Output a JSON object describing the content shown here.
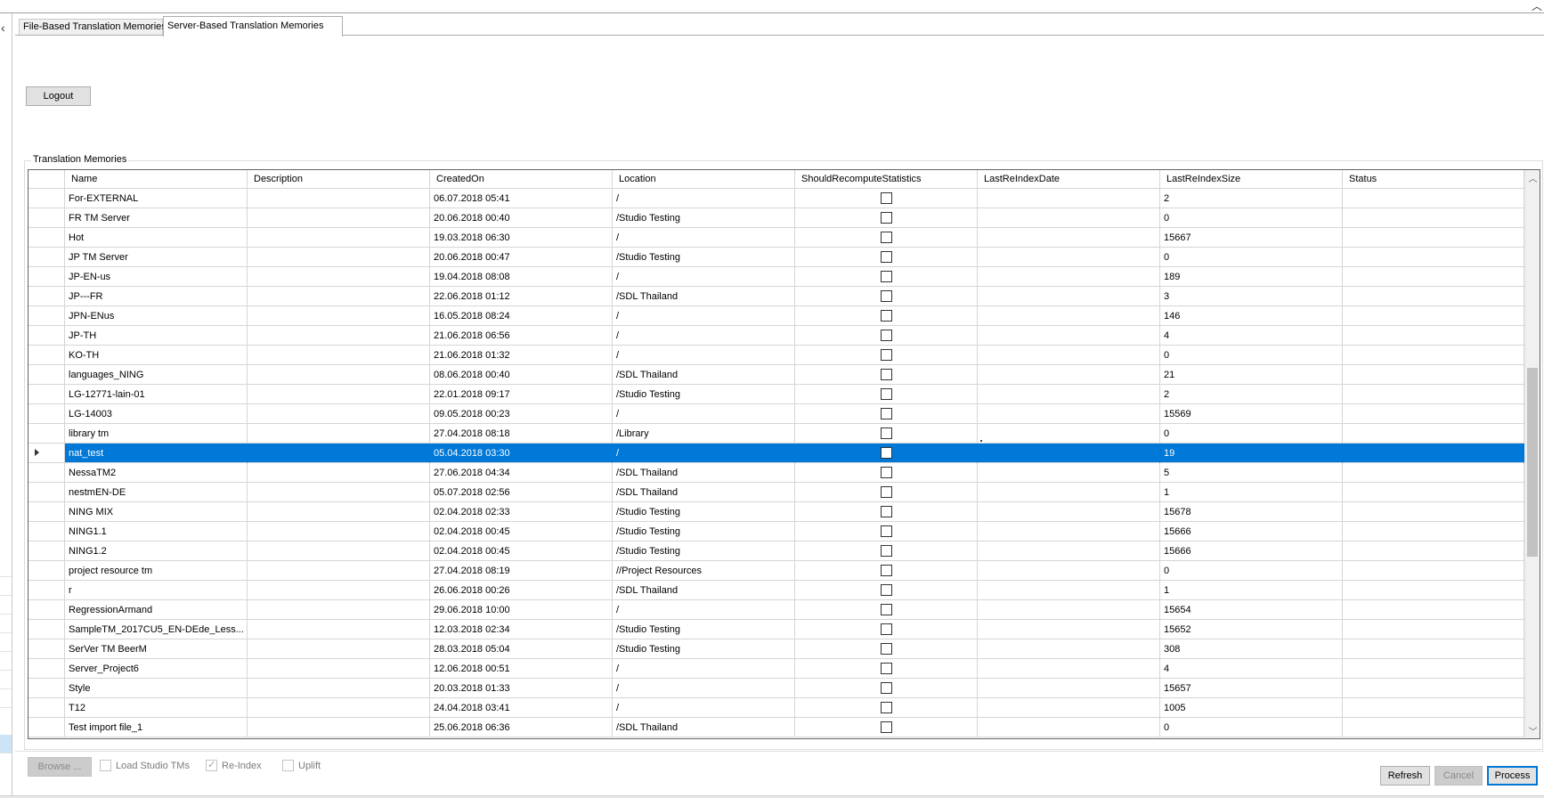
{
  "tabs": [
    {
      "label": "File-Based Translation Memories"
    },
    {
      "label": "Server-Based Translation Memories"
    }
  ],
  "logout_label": "Logout",
  "group_title": "Translation Memories",
  "columns": [
    "Name",
    "Description",
    "CreatedOn",
    "Location",
    "ShouldRecomputeStatistics",
    "LastReIndexDate",
    "LastReIndexSize",
    "Status"
  ],
  "rows": [
    {
      "name": "For-EXTERNAL",
      "description": "",
      "created": "06.07.2018 05:41",
      "location": "/",
      "recompute": false,
      "reindex_date": "",
      "reindex_size": "2",
      "status": ""
    },
    {
      "name": "FR TM Server",
      "description": "",
      "created": "20.06.2018 00:40",
      "location": "/Studio Testing",
      "recompute": false,
      "reindex_date": "",
      "reindex_size": "0",
      "status": ""
    },
    {
      "name": "Hot",
      "description": "",
      "created": "19.03.2018 06:30",
      "location": "/",
      "recompute": false,
      "reindex_date": "",
      "reindex_size": "15667",
      "status": ""
    },
    {
      "name": "JP TM Server",
      "description": "",
      "created": "20.06.2018 00:47",
      "location": "/Studio Testing",
      "recompute": false,
      "reindex_date": "",
      "reindex_size": "0",
      "status": ""
    },
    {
      "name": "JP-EN-us",
      "description": "",
      "created": "19.04.2018 08:08",
      "location": "/",
      "recompute": false,
      "reindex_date": "",
      "reindex_size": "189",
      "status": ""
    },
    {
      "name": "JP---FR",
      "description": "",
      "created": "22.06.2018 01:12",
      "location": "/SDL Thailand",
      "recompute": false,
      "reindex_date": "",
      "reindex_size": "3",
      "status": ""
    },
    {
      "name": "JPN-ENus",
      "description": "",
      "created": "16.05.2018 08:24",
      "location": "/",
      "recompute": false,
      "reindex_date": "",
      "reindex_size": "146",
      "status": ""
    },
    {
      "name": "JP-TH",
      "description": "",
      "created": "21.06.2018 06:56",
      "location": "/",
      "recompute": false,
      "reindex_date": "",
      "reindex_size": "4",
      "status": ""
    },
    {
      "name": "KO-TH",
      "description": "",
      "created": "21.06.2018 01:32",
      "location": "/",
      "recompute": false,
      "reindex_date": "",
      "reindex_size": "0",
      "status": ""
    },
    {
      "name": "languages_NING",
      "description": "",
      "created": "08.06.2018 00:40",
      "location": "/SDL Thailand",
      "recompute": false,
      "reindex_date": "",
      "reindex_size": "21",
      "status": ""
    },
    {
      "name": "LG-12771-lain-01",
      "description": "",
      "created": "22.01.2018 09:17",
      "location": "/Studio Testing",
      "recompute": false,
      "reindex_date": "",
      "reindex_size": "2",
      "status": ""
    },
    {
      "name": "LG-14003",
      "description": "",
      "created": "09.05.2018 00:23",
      "location": "/",
      "recompute": false,
      "reindex_date": "",
      "reindex_size": "15569",
      "status": ""
    },
    {
      "name": "library tm",
      "description": "",
      "created": "27.04.2018 08:18",
      "location": "/Library",
      "recompute": false,
      "reindex_date": "",
      "reindex_size": "0",
      "status": ""
    },
    {
      "name": "nat_test",
      "description": "",
      "created": "05.04.2018 03:30",
      "location": "/",
      "recompute": false,
      "reindex_date": "",
      "reindex_size": "19",
      "status": "",
      "selected": true
    },
    {
      "name": "NessaTM2",
      "description": "",
      "created": "27.06.2018 04:34",
      "location": "/SDL Thailand",
      "recompute": false,
      "reindex_date": "",
      "reindex_size": "5",
      "status": ""
    },
    {
      "name": "nestmEN-DE",
      "description": "",
      "created": "05.07.2018 02:56",
      "location": "/SDL Thailand",
      "recompute": false,
      "reindex_date": "",
      "reindex_size": "1",
      "status": ""
    },
    {
      "name": "NING MIX",
      "description": "",
      "created": "02.04.2018 02:33",
      "location": "/Studio Testing",
      "recompute": false,
      "reindex_date": "",
      "reindex_size": "15678",
      "status": ""
    },
    {
      "name": "NING1.1",
      "description": "",
      "created": "02.04.2018 00:45",
      "location": "/Studio Testing",
      "recompute": false,
      "reindex_date": "",
      "reindex_size": "15666",
      "status": ""
    },
    {
      "name": "NING1.2",
      "description": "",
      "created": "02.04.2018 00:45",
      "location": "/Studio Testing",
      "recompute": false,
      "reindex_date": "",
      "reindex_size": "15666",
      "status": ""
    },
    {
      "name": "project resource tm",
      "description": "",
      "created": "27.04.2018 08:19",
      "location": "//Project Resources",
      "recompute": false,
      "reindex_date": "",
      "reindex_size": "0",
      "status": ""
    },
    {
      "name": "r",
      "description": "",
      "created": "26.06.2018 00:26",
      "location": "/SDL Thailand",
      "recompute": false,
      "reindex_date": "",
      "reindex_size": "1",
      "status": ""
    },
    {
      "name": "RegressionArmand",
      "description": "",
      "created": "29.06.2018 10:00",
      "location": "/",
      "recompute": false,
      "reindex_date": "",
      "reindex_size": "15654",
      "status": ""
    },
    {
      "name": "SampleTM_2017CU5_EN-DEde_Less...",
      "description": "",
      "created": "12.03.2018 02:34",
      "location": "/Studio Testing",
      "recompute": false,
      "reindex_date": "",
      "reindex_size": "15652",
      "status": ""
    },
    {
      "name": "SerVer TM BeerM",
      "description": "",
      "created": "28.03.2018 05:04",
      "location": "/Studio Testing",
      "recompute": false,
      "reindex_date": "",
      "reindex_size": "308",
      "status": ""
    },
    {
      "name": "Server_Project6",
      "description": "",
      "created": "12.06.2018 00:51",
      "location": "/",
      "recompute": false,
      "reindex_date": "",
      "reindex_size": "4",
      "status": ""
    },
    {
      "name": "Style",
      "description": "",
      "created": "20.03.2018 01:33",
      "location": "/",
      "recompute": false,
      "reindex_date": "",
      "reindex_size": "15657",
      "status": ""
    },
    {
      "name": "T12",
      "description": "",
      "created": "24.04.2018 03:41",
      "location": "/",
      "recompute": false,
      "reindex_date": "",
      "reindex_size": "1005",
      "status": ""
    },
    {
      "name": "Test import file_1",
      "description": "",
      "created": "25.06.2018 06:36",
      "location": "/SDL Thailand",
      "recompute": false,
      "reindex_date": "",
      "reindex_size": "0",
      "status": ""
    }
  ],
  "options": {
    "browse_label": "Browse ...",
    "load_studio_label": "Load Studio TMs",
    "reindex_label": "Re-Index",
    "uplift_label": "Uplift"
  },
  "buttons": {
    "refresh": "Refresh",
    "cancel": "Cancel",
    "process": "Process"
  },
  "icons": {
    "left_arrow": "chevron-left-icon",
    "top_right": "chevron-up-icon",
    "scroll_up": "scroll-up-arrow-icon",
    "scroll_down": "scroll-down-arrow-icon",
    "row_indicator": "row-pointer-icon"
  },
  "colors": {
    "selection": "#0078d7",
    "primary_border": "#0078d7"
  }
}
